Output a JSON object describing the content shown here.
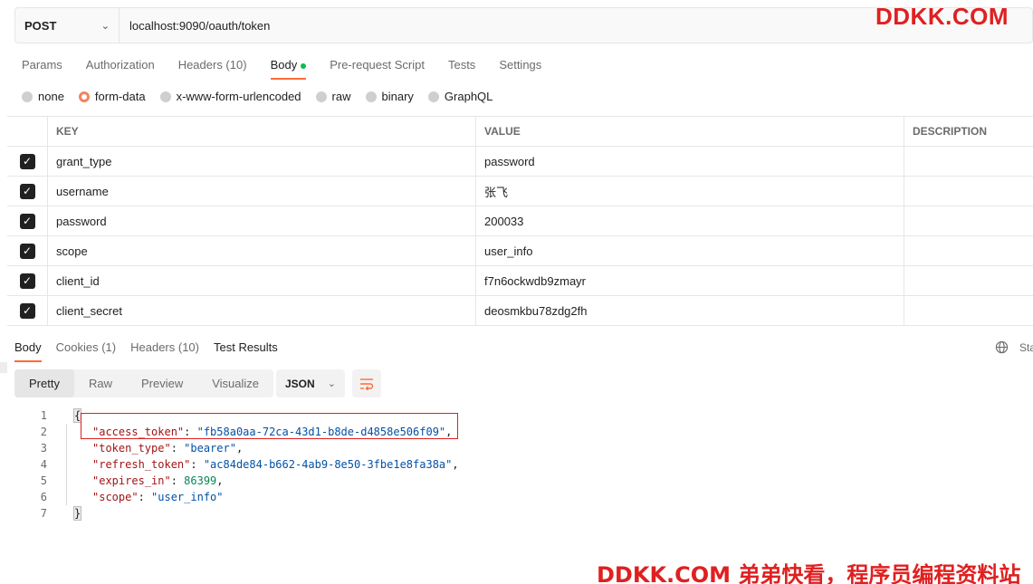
{
  "request": {
    "method": "POST",
    "url": "localhost:9090/oauth/token"
  },
  "watermarks": {
    "top": "DDKK.COM",
    "bottom": "DDKK.COM 弟弟快看，程序员编程资料站"
  },
  "request_tabs": [
    {
      "label": "Params"
    },
    {
      "label": "Authorization"
    },
    {
      "label": "Headers (10)"
    },
    {
      "label": "Body"
    },
    {
      "label": "Pre-request Script"
    },
    {
      "label": "Tests"
    },
    {
      "label": "Settings"
    }
  ],
  "body_types": [
    {
      "label": "none"
    },
    {
      "label": "form-data"
    },
    {
      "label": "x-www-form-urlencoded"
    },
    {
      "label": "raw"
    },
    {
      "label": "binary"
    },
    {
      "label": "GraphQL"
    }
  ],
  "table": {
    "headers": {
      "key": "KEY",
      "value": "VALUE",
      "description": "DESCRIPTION"
    },
    "rows": [
      {
        "key": "grant_type",
        "value": "password"
      },
      {
        "key": "username",
        "value": "张飞"
      },
      {
        "key": "password",
        "value": "200033"
      },
      {
        "key": "scope",
        "value": "user_info"
      },
      {
        "key": "client_id",
        "value": "f7n6ockwdb9zmayr"
      },
      {
        "key": "client_secret",
        "value": "deosmkbu78zdg2fh"
      }
    ]
  },
  "response_tabs": [
    {
      "label": "Body"
    },
    {
      "label": "Cookies (1)"
    },
    {
      "label": "Headers (10)"
    },
    {
      "label": "Test Results"
    }
  ],
  "status_cut": "Sta",
  "view_modes": [
    {
      "label": "Pretty"
    },
    {
      "label": "Raw"
    },
    {
      "label": "Preview"
    },
    {
      "label": "Visualize"
    }
  ],
  "format": "JSON",
  "response": {
    "line_numbers": [
      "1",
      "2",
      "3",
      "4",
      "5",
      "6",
      "7"
    ],
    "open_brace": "{",
    "close_brace": "}",
    "fields": [
      {
        "key": "\"access_token\"",
        "value": "\"fb58a0aa-72ca-43d1-b8de-d4858e506f09\"",
        "comma": ","
      },
      {
        "key": "\"token_type\"",
        "value": "\"bearer\"",
        "comma": ","
      },
      {
        "key": "\"refresh_token\"",
        "value": "\"ac84de84-b662-4ab9-8e50-3fbe1e8fa38a\"",
        "comma": ","
      },
      {
        "key": "\"expires_in\"",
        "value": "86399",
        "comma": ","
      },
      {
        "key": "\"scope\"",
        "value": "\"user_info\"",
        "comma": ""
      }
    ]
  },
  "colors": {
    "accent": "#ff6c37",
    "watermark": "#e02020",
    "json_key": "#a31515",
    "json_string": "#0451a5",
    "json_number": "#098658"
  }
}
